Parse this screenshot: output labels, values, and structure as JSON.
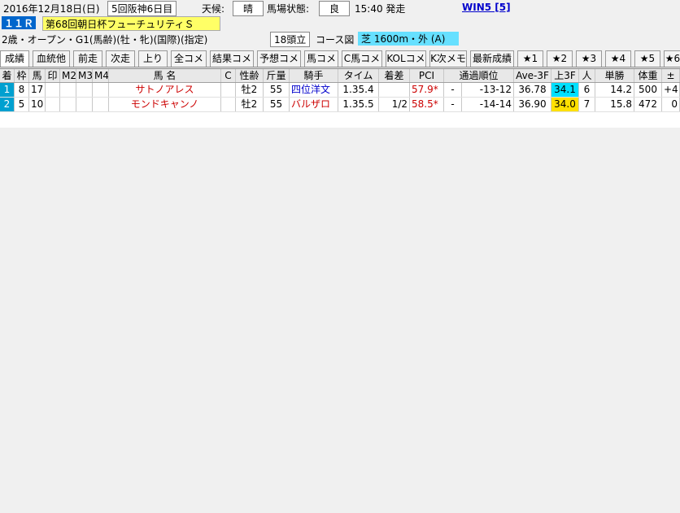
{
  "header": {
    "date": "2016年12月18日(日)",
    "meeting": "5回阪神6日目",
    "weather_label": "天候:",
    "weather": "晴",
    "track_label": "馬場状態:",
    "track": "良",
    "post_time": "15:40 発走",
    "win5": "WIN5 [5]"
  },
  "race": {
    "number": "１１Ｒ",
    "name": "第68回朝日杯フューチュリティＳ",
    "conditions": "2歳・オープン・G1(馬齢)(牡・牝)(国際)(指定)",
    "field": "18頭立",
    "course_label": "コース図",
    "course": "芝 1600m・外 (A)"
  },
  "tabs": [
    "成績",
    "血統他",
    "前走",
    "次走",
    "上り",
    "全コメ",
    "結果コメ",
    "予想コメ",
    "馬コメ",
    "C馬コメ",
    "KOLコメ",
    "K次メモ",
    "最新成績",
    "★1",
    "★2",
    "★3",
    "★4",
    "★5",
    "★6"
  ],
  "columns": [
    "着",
    "枠",
    "馬",
    "印",
    "M2",
    "M3",
    "M4",
    "馬 名",
    "C",
    "性齢",
    "斤量",
    "騎手",
    "タイム",
    "着差",
    "PCI",
    "通過順位",
    "Ave-3F",
    "上3F",
    "人",
    "単勝",
    "体重",
    "±"
  ],
  "rows": [
    [
      "1",
      "8",
      "17",
      "",
      "",
      "",
      "",
      "サトノアレス",
      "",
      "牡2",
      "55",
      "四位洋文",
      "1.35.4",
      "",
      "57.9*",
      "-",
      "-13-12",
      "36.78",
      "34.1",
      "6",
      "14.2",
      "500",
      "+4"
    ],
    [
      "2",
      "5",
      "10",
      "",
      "",
      "",
      "",
      "モンドキャンノ",
      "",
      "牡2",
      "55",
      "バルザロ",
      "1.35.5",
      "1/2",
      "58.5*",
      "-",
      "-14-14",
      "36.90",
      "34.0",
      "7",
      "15.8",
      "472",
      "0"
    ]
  ],
  "colors": {
    "row_number_bg": "#00a0d0",
    "last3f_first": "#00e0ff",
    "last3f_second": "#ffe000"
  }
}
